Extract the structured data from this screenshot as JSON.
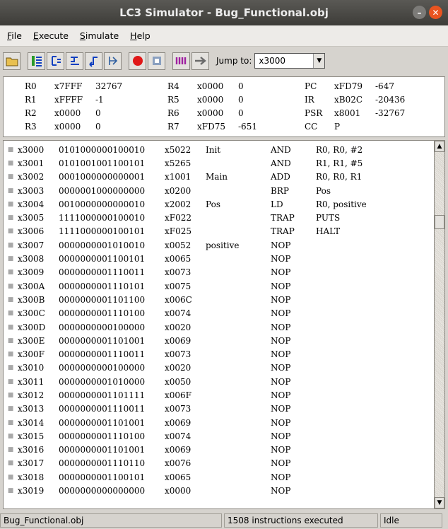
{
  "window": {
    "title": "LC3 Simulator - Bug_Functional.obj"
  },
  "menu": [
    {
      "pre": "",
      "u": "F",
      "post": "ile"
    },
    {
      "pre": "",
      "u": "E",
      "post": "xecute"
    },
    {
      "pre": "",
      "u": "S",
      "post": "imulate"
    },
    {
      "pre": "",
      "u": "H",
      "post": "elp"
    }
  ],
  "toolbar": {
    "icons": [
      "open-folder-icon",
      "step-in-icon",
      "step-over-icon",
      "step-out-icon",
      "step-back-icon",
      "stop-icon",
      "run-icon",
      "clear-icon",
      "breakpoint-icon",
      "jump-arrow-icon"
    ],
    "jump_label": "Jump to:",
    "jump_value": "x3000"
  },
  "registers": {
    "col1": [
      {
        "name": "R0",
        "hex": "x7FFF",
        "dec": "32767"
      },
      {
        "name": "R1",
        "hex": "xFFFF",
        "dec": "-1"
      },
      {
        "name": "R2",
        "hex": "x0000",
        "dec": "0"
      },
      {
        "name": "R3",
        "hex": "x0000",
        "dec": "0"
      }
    ],
    "col2": [
      {
        "name": "R4",
        "hex": "x0000",
        "dec": "0"
      },
      {
        "name": "R5",
        "hex": "x0000",
        "dec": "0"
      },
      {
        "name": "R6",
        "hex": "x0000",
        "dec": "0"
      },
      {
        "name": "R7",
        "hex": "xFD75",
        "dec": "-651"
      }
    ],
    "col3": [
      {
        "name": "PC",
        "hex": "xFD79",
        "dec": "-647"
      },
      {
        "name": "IR",
        "hex": "xB02C",
        "dec": "-20436"
      },
      {
        "name": "PSR",
        "hex": "x8001",
        "dec": "-32767"
      },
      {
        "name": "CC",
        "hex": "P",
        "dec": ""
      }
    ]
  },
  "listing": [
    {
      "addr": "x3000",
      "bin": "0101000000100010",
      "hex": "x5022",
      "label": "Init",
      "op": "AND",
      "args": "R0, R0, #2"
    },
    {
      "addr": "x3001",
      "bin": "0101001001100101",
      "hex": "x5265",
      "label": "",
      "op": "AND",
      "args": "R1, R1, #5"
    },
    {
      "addr": "x3002",
      "bin": "0001000000000001",
      "hex": "x1001",
      "label": "Main",
      "op": "ADD",
      "args": "R0, R0, R1"
    },
    {
      "addr": "x3003",
      "bin": "0000001000000000",
      "hex": "x0200",
      "label": "",
      "op": "BRP",
      "args": "Pos"
    },
    {
      "addr": "x3004",
      "bin": "0010000000000010",
      "hex": "x2002",
      "label": "Pos",
      "op": "LD",
      "args": "R0, positive"
    },
    {
      "addr": "x3005",
      "bin": "1111000000100010",
      "hex": "xF022",
      "label": "",
      "op": "TRAP",
      "args": "PUTS"
    },
    {
      "addr": "x3006",
      "bin": "1111000000100101",
      "hex": "xF025",
      "label": "",
      "op": "TRAP",
      "args": "HALT"
    },
    {
      "addr": "x3007",
      "bin": "0000000001010010",
      "hex": "x0052",
      "label": "positive",
      "op": "NOP",
      "args": ""
    },
    {
      "addr": "x3008",
      "bin": "0000000001100101",
      "hex": "x0065",
      "label": "",
      "op": "NOP",
      "args": ""
    },
    {
      "addr": "x3009",
      "bin": "0000000001110011",
      "hex": "x0073",
      "label": "",
      "op": "NOP",
      "args": ""
    },
    {
      "addr": "x300A",
      "bin": "0000000001110101",
      "hex": "x0075",
      "label": "",
      "op": "NOP",
      "args": ""
    },
    {
      "addr": "x300B",
      "bin": "0000000001101100",
      "hex": "x006C",
      "label": "",
      "op": "NOP",
      "args": ""
    },
    {
      "addr": "x300C",
      "bin": "0000000001110100",
      "hex": "x0074",
      "label": "",
      "op": "NOP",
      "args": ""
    },
    {
      "addr": "x300D",
      "bin": "0000000000100000",
      "hex": "x0020",
      "label": "",
      "op": "NOP",
      "args": ""
    },
    {
      "addr": "x300E",
      "bin": "0000000001101001",
      "hex": "x0069",
      "label": "",
      "op": "NOP",
      "args": ""
    },
    {
      "addr": "x300F",
      "bin": "0000000001110011",
      "hex": "x0073",
      "label": "",
      "op": "NOP",
      "args": ""
    },
    {
      "addr": "x3010",
      "bin": "0000000000100000",
      "hex": "x0020",
      "label": "",
      "op": "NOP",
      "args": ""
    },
    {
      "addr": "x3011",
      "bin": "0000000001010000",
      "hex": "x0050",
      "label": "",
      "op": "NOP",
      "args": ""
    },
    {
      "addr": "x3012",
      "bin": "0000000001101111",
      "hex": "x006F",
      "label": "",
      "op": "NOP",
      "args": ""
    },
    {
      "addr": "x3013",
      "bin": "0000000001110011",
      "hex": "x0073",
      "label": "",
      "op": "NOP",
      "args": ""
    },
    {
      "addr": "x3014",
      "bin": "0000000001101001",
      "hex": "x0069",
      "label": "",
      "op": "NOP",
      "args": ""
    },
    {
      "addr": "x3015",
      "bin": "0000000001110100",
      "hex": "x0074",
      "label": "",
      "op": "NOP",
      "args": ""
    },
    {
      "addr": "x3016",
      "bin": "0000000001101001",
      "hex": "x0069",
      "label": "",
      "op": "NOP",
      "args": ""
    },
    {
      "addr": "x3017",
      "bin": "0000000001110110",
      "hex": "x0076",
      "label": "",
      "op": "NOP",
      "args": ""
    },
    {
      "addr": "x3018",
      "bin": "0000000001100101",
      "hex": "x0065",
      "label": "",
      "op": "NOP",
      "args": ""
    },
    {
      "addr": "x3019",
      "bin": "0000000000000000",
      "hex": "x0000",
      "label": "",
      "op": "NOP",
      "args": ""
    }
  ],
  "status": {
    "file": "Bug_Functional.obj",
    "executed": "1508 instructions executed",
    "state": "Idle"
  }
}
